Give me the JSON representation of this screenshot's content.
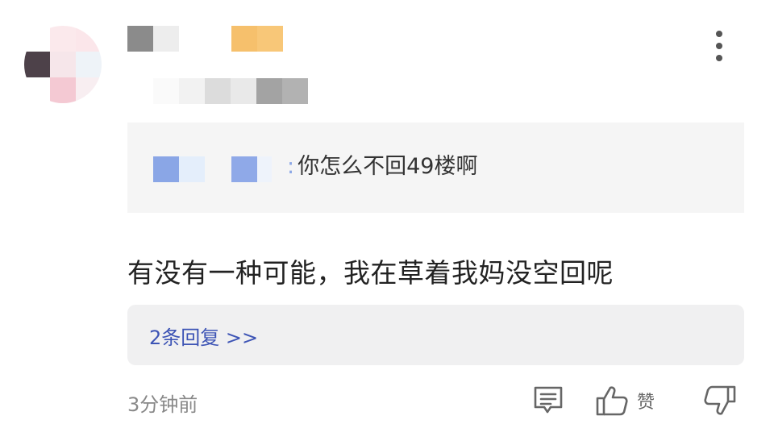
{
  "quote": {
    "text": "你怎么不回49楼啊",
    "colon": ":"
  },
  "comment": {
    "text": "有没有一种可能，我在草着我妈没空回呢"
  },
  "replies": {
    "label": "2条回复 >>"
  },
  "meta": {
    "timestamp": "3分钟前",
    "like_label": "赞"
  },
  "icons": {
    "more": "more-vertical-icon",
    "reply": "comment-icon",
    "like": "thumbs-up-icon",
    "dislike": "thumbs-down-icon"
  },
  "colors": {
    "link": "#3d54b5",
    "quote_bg": "#f5f5f5",
    "replies_bg": "#f0f0f1",
    "muted": "#888888"
  }
}
